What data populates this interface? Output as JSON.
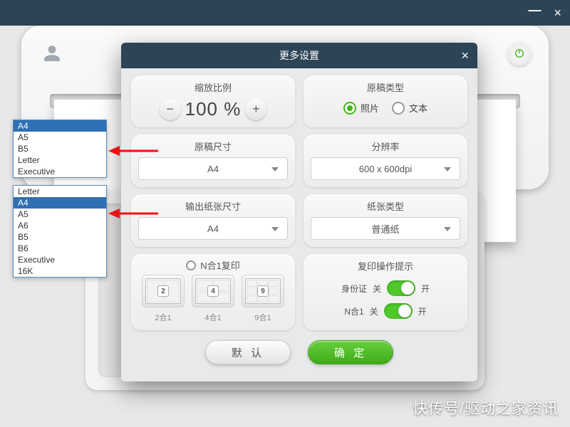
{
  "titlebar": {
    "min": "—",
    "close": "×"
  },
  "modal": {
    "title": "更多设置",
    "close": "×",
    "zoom": {
      "label": "缩放比例",
      "value": "100 %",
      "minus": "−",
      "plus": "+"
    },
    "doctype": {
      "label": "原稿类型",
      "opt_photo": "照片",
      "opt_text": "文本"
    },
    "docsize": {
      "label": "原稿尺寸",
      "value": "A4"
    },
    "resolution": {
      "label": "分辨率",
      "value": "600 x 600dpi"
    },
    "outsize": {
      "label": "输出纸张尺寸",
      "value": "A4"
    },
    "papertype": {
      "label": "纸张类型",
      "value": "普通纸"
    },
    "nin1": {
      "label": "N合1复印",
      "n2": "2",
      "n4": "4",
      "n9": "9",
      "l2": "2合1",
      "l4": "4合1",
      "l9": "9合1"
    },
    "tips": {
      "label": "复印操作提示",
      "id_label": "身份证",
      "off": "关",
      "on": "开",
      "n_label": "N合1"
    },
    "btn_default": "默 认",
    "btn_ok": "确 定"
  },
  "list1": {
    "items": [
      "A4",
      "A5",
      "B5",
      "Letter",
      "Executive"
    ],
    "selectedIndex": 0
  },
  "list2": {
    "items": [
      "Letter",
      "A4",
      "A5",
      "A6",
      "B5",
      "B6",
      "Executive",
      "16K"
    ],
    "selectedIndex": 1
  },
  "watermark": "快传号/驱动之家资讯"
}
